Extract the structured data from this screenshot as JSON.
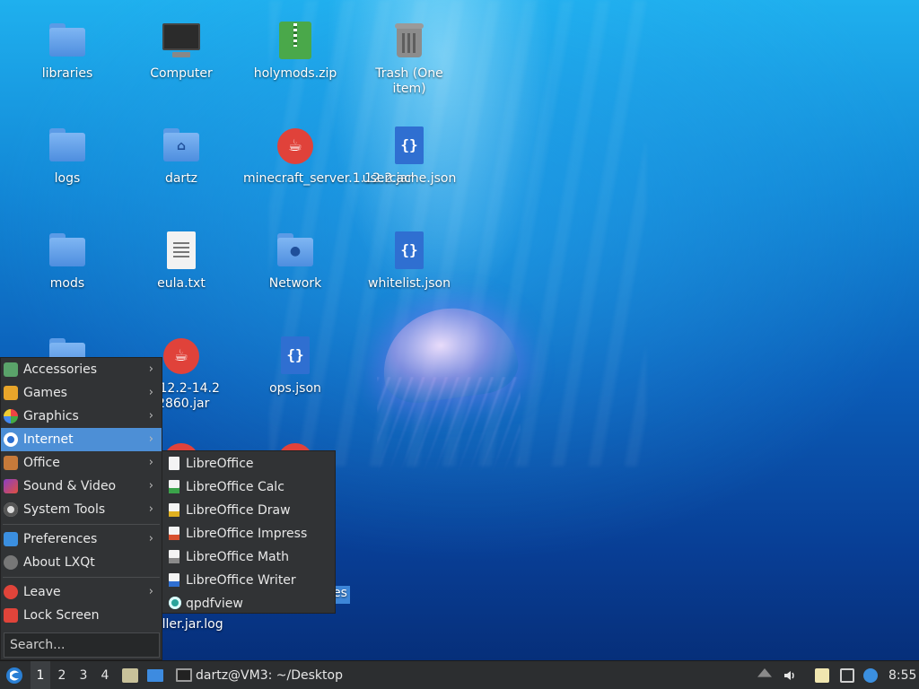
{
  "desktop": {
    "icons": [
      {
        "label": "libraries",
        "type": "folder"
      },
      {
        "label": "Computer",
        "type": "computer"
      },
      {
        "label": "holymods.zip",
        "type": "zip"
      },
      {
        "label": "Trash (One item)",
        "type": "trash"
      },
      {
        "label": "logs",
        "type": "folder"
      },
      {
        "label": "dartz",
        "type": "home-folder"
      },
      {
        "label": "minecraft_server.1.12.2.jar",
        "type": "java"
      },
      {
        "label": "usercache.json",
        "type": "json"
      },
      {
        "label": "mods",
        "type": "folder"
      },
      {
        "label": "eula.txt",
        "type": "text"
      },
      {
        "label": "Network",
        "type": "network-folder"
      },
      {
        "label": "whitelist.json",
        "type": "json"
      },
      {
        "label": "-1.12.2-14.2 .2860.jar",
        "type": "java"
      },
      {
        "label": "ops.json",
        "type": "json"
      },
      {
        "label": "aller.jar.log",
        "type": "log"
      },
      {
        "label": "es",
        "type": "partial"
      }
    ]
  },
  "start_menu": {
    "items": [
      {
        "label": "Accessories",
        "icon": "accessories-icon",
        "submenu": true
      },
      {
        "label": "Games",
        "icon": "games-icon",
        "submenu": true
      },
      {
        "label": "Graphics",
        "icon": "graphics-icon",
        "submenu": true
      },
      {
        "label": "Internet",
        "icon": "internet-icon",
        "submenu": true,
        "active": true
      },
      {
        "label": "Office",
        "icon": "office-icon",
        "submenu": true
      },
      {
        "label": "Sound & Video",
        "icon": "sound-video-icon",
        "submenu": true
      },
      {
        "label": "System Tools",
        "icon": "system-tools-icon",
        "submenu": true
      },
      {
        "label": "Preferences",
        "icon": "preferences-icon",
        "submenu": true
      },
      {
        "label": "About LXQt",
        "icon": "about-icon",
        "submenu": false
      },
      {
        "label": "Leave",
        "icon": "leave-icon",
        "submenu": true
      },
      {
        "label": "Lock Screen",
        "icon": "lock-icon",
        "submenu": false
      }
    ],
    "search_placeholder": "Search...",
    "arrow": "›"
  },
  "submenu": {
    "items": [
      {
        "label": "LibreOffice"
      },
      {
        "label": "LibreOffice Calc"
      },
      {
        "label": "LibreOffice Draw"
      },
      {
        "label": "LibreOffice Impress"
      },
      {
        "label": "LibreOffice Math"
      },
      {
        "label": "LibreOffice Writer"
      },
      {
        "label": "qpdfview"
      }
    ]
  },
  "taskbar": {
    "desktops": [
      "1",
      "2",
      "3",
      "4"
    ],
    "current_desktop": "1",
    "window_title": "dartz@VM3: ~/Desktop",
    "clock": "8:55"
  },
  "colors": {
    "accent": "#4d8fd6",
    "menu_bg": "#313335",
    "taskbar_bg": "#2c2e30"
  }
}
